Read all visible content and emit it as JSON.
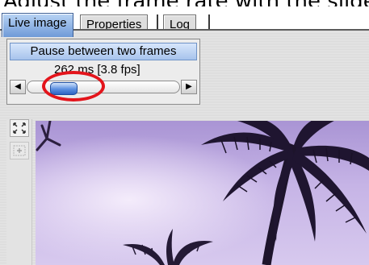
{
  "caption": {
    "text": "Adjust the frame rate with the slider"
  },
  "tabs": [
    {
      "label": "Live image",
      "active": true
    },
    {
      "label": "Properties",
      "active": false
    },
    {
      "label": "Log",
      "active": false
    }
  ],
  "frame_control": {
    "title": "Pause between two frames",
    "value_text": "262 ms [3.8 fps]",
    "slider_position": 0.18,
    "left_arrow_icon": "arrow-left-icon",
    "right_arrow_icon": "arrow-right-icon"
  },
  "toolbar": {
    "fit_icon": "fit-to-window-icon",
    "zoom_icon": "zoom-in-icon",
    "zoom_disabled": true
  },
  "image": {
    "subject": "palm-tree-silhouette"
  },
  "colors": {
    "active_tab": "#6f9ad8",
    "title_bar": "#a7c3ec",
    "slider_thumb": "#2f63c2",
    "highlight": "#e3141b",
    "sky": "#c4b1e4"
  }
}
